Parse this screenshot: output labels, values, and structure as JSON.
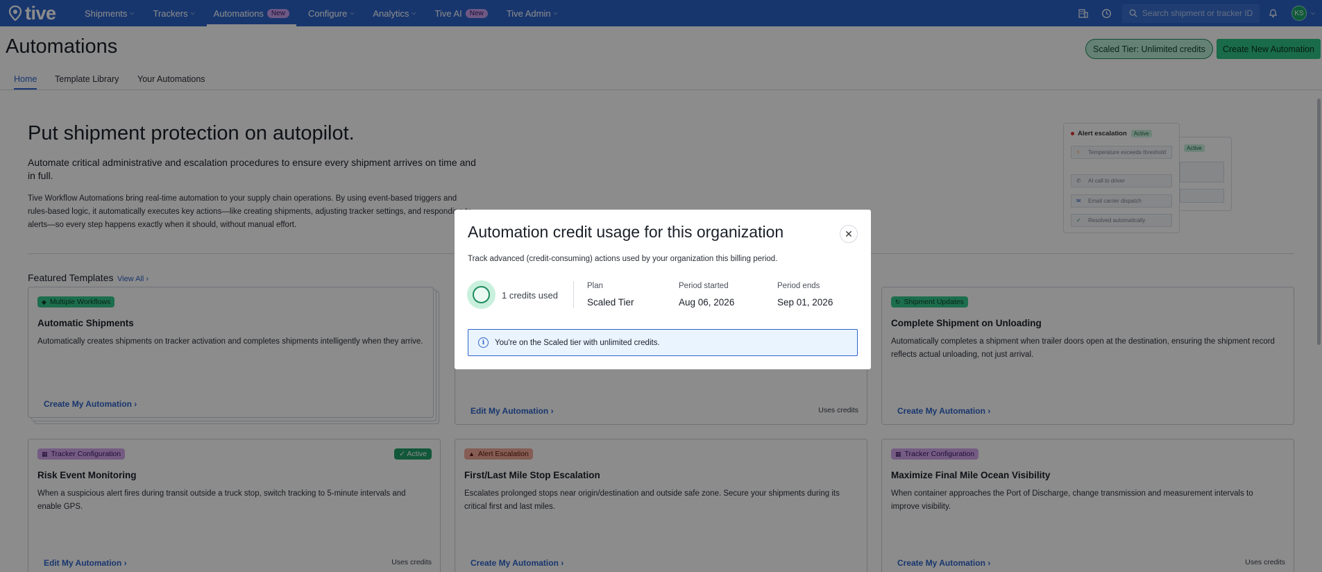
{
  "nav": {
    "logo_text": "tive",
    "items": [
      {
        "label": "Shipments",
        "has_dropdown": true
      },
      {
        "label": "Trackers",
        "has_dropdown": true
      },
      {
        "label": "Automations",
        "badge": "New",
        "active": true
      },
      {
        "label": "Configure",
        "has_dropdown": true
      },
      {
        "label": "Analytics",
        "has_dropdown": true
      },
      {
        "label": "Tive AI",
        "badge": "New"
      },
      {
        "label": "Tive Admin",
        "has_dropdown": true
      }
    ],
    "search_placeholder": "Search shipment or tracker ID",
    "avatar_initials": "KS",
    "icons": [
      "building-icon",
      "history-icon",
      "search-icon",
      "bell-icon"
    ]
  },
  "header": {
    "title": "Automations",
    "tier_button": "Scaled Tier: Unlimited credits",
    "create_button": "Create New Automation"
  },
  "tabs": [
    "Home",
    "Template Library",
    "Your Automations"
  ],
  "hero": {
    "headline": "Put shipment protection on autopilot.",
    "subhead": "Automate critical administrative and escalation procedures to ensure every shipment arrives on time and in full.",
    "body": "Tive Workflow Automations bring real-time automation to your supply chain operations. By using event-based triggers and rules-based logic, it automatically executes key actions—like creating shipments, adjusting tracker settings, and responding to alerts—so every step happens exactly when it should, without manual effort.",
    "mock": {
      "title": "Alert escalation",
      "status": "Active",
      "back_status": "Active",
      "steps": [
        "Temperature exceeds threshold",
        "AI call to driver",
        "Email carrier dispatch",
        "Resolved automatically"
      ]
    }
  },
  "featured": {
    "title": "Featured Templates",
    "view_all": "View All",
    "cards": [
      {
        "tag": "Multiple Workflows",
        "title": "Automatic Shipments",
        "desc": "Automatically creates shipments on tracker activation and completes shipments intelligently when they arrive.",
        "link": "Create My Automation",
        "meta": ""
      },
      {
        "tag": "",
        "title": "",
        "desc": "",
        "link": "Edit My Automation",
        "meta": "Uses credits"
      },
      {
        "tag": "Shipment Updates",
        "title": "Complete Shipment on Unloading",
        "desc": "Automatically completes a shipment when trailer doors open at the destination, ensuring the shipment record reflects actual unloading, not just arrival.",
        "link": "Create My Automation",
        "meta": ""
      },
      {
        "tag": "Tracker Configuration",
        "title": "Risk Event Monitoring",
        "desc": "When a suspicious alert fires during transit outside a truck stop, switch tracking to 5-minute intervals and enable GPS.",
        "link": "Edit My Automation",
        "meta": "Uses credits",
        "status": "Active"
      },
      {
        "tag": "Alert Escalation",
        "title": "First/Last Mile Stop Escalation",
        "desc": "Escalates prolonged stops near origin/destination and outside safe zone. Secure your shipments during its critical first and last miles.",
        "link": "Create My Automation",
        "meta": ""
      },
      {
        "tag": "Tracker Configuration",
        "title": "Maximize Final Mile Ocean Visibility",
        "desc": "When container approaches the Port of Discharge, change transmission and measurement intervals to improve visibility.",
        "link": "Create My Automation",
        "meta": "Uses credits"
      }
    ]
  },
  "modal": {
    "title": "Automation credit usage for this organization",
    "description": "Track advanced (credit-consuming) actions used by your organization this billing period.",
    "credits_used": "1 credits used",
    "plan_label": "Plan",
    "plan_value": "Scaled Tier",
    "period_started_label": "Period started",
    "period_started_value": "Aug 06, 2026",
    "period_ends_label": "Period ends",
    "period_ends_value": "Sep 01, 2026",
    "info": "You're on the Scaled tier with unlimited credits.",
    "close_icon": "close-icon"
  },
  "colors": {
    "nav_bg": "#2d63c8",
    "accent_green": "#2fc486",
    "link_blue": "#2d63c8"
  }
}
